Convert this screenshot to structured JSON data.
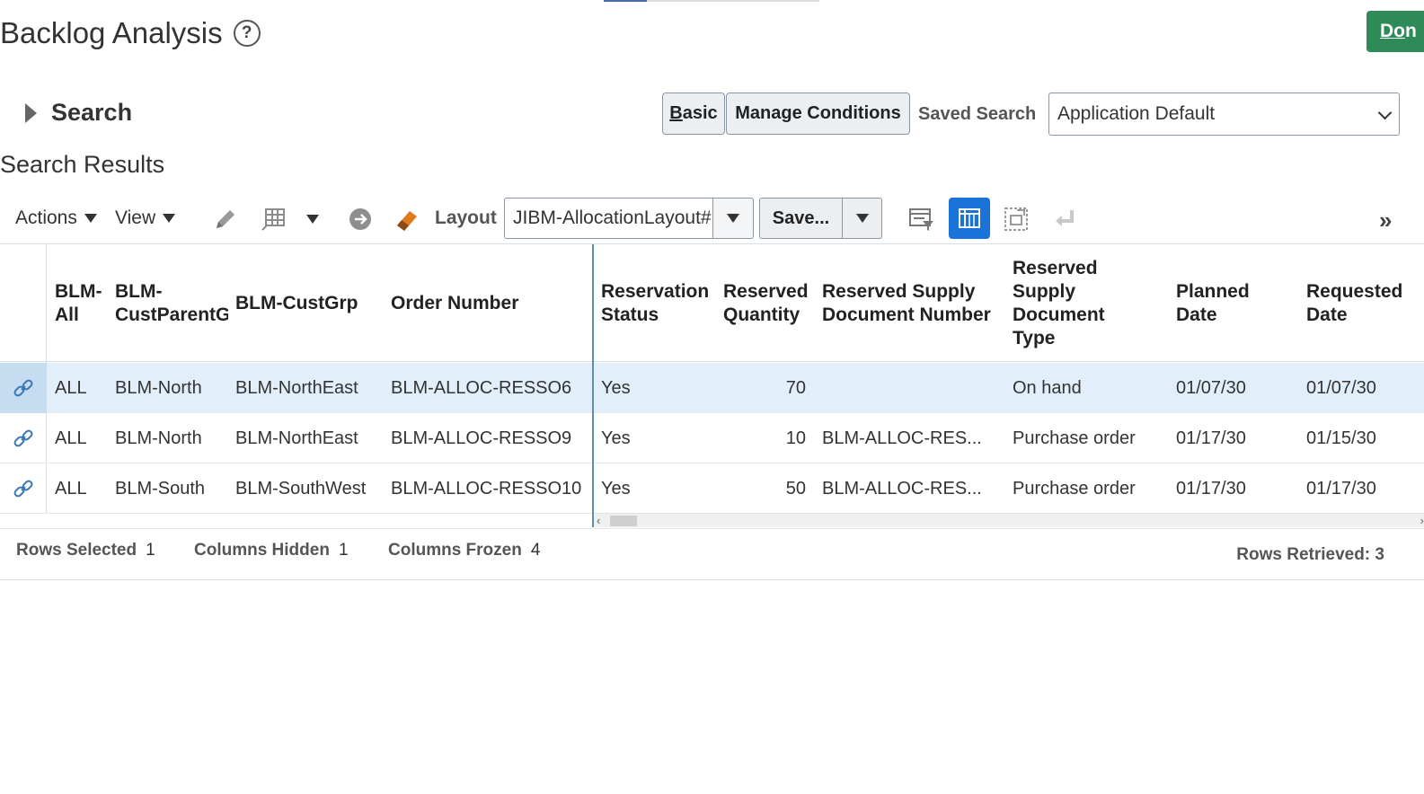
{
  "page": {
    "title": "Backlog Analysis",
    "done_label": "Do",
    "done_accel": "n"
  },
  "search": {
    "label": "Search",
    "basic_label": "asic",
    "basic_accel": "B",
    "manage_conditions_label": "Manage Conditions",
    "saved_search_label": "Saved Search",
    "saved_search_value": "Application Default"
  },
  "results": {
    "title": "Search Results",
    "toolbar": {
      "actions_label": "Actions",
      "view_label": "View",
      "layout_label": "Layout",
      "layout_value": "JIBM-AllocationLayout#",
      "save_label": "Save..."
    },
    "columns": [
      "BLM-All",
      "BLM-CustParentG",
      "BLM-CustGrp",
      "Order Number",
      "Reservation Status",
      "Reserved Quantity",
      "Reserved Supply Document Number",
      "Reserved Supply Document Type",
      "Planned Date",
      "Requested Date"
    ],
    "rows": [
      {
        "selected": true,
        "cells": [
          "ALL",
          "BLM-North",
          "BLM-NorthEast",
          "BLM-ALLOC-RESSO6",
          "Yes",
          "70",
          "",
          "On hand",
          "01/07/30",
          "01/07/30"
        ]
      },
      {
        "selected": false,
        "cells": [
          "ALL",
          "BLM-North",
          "BLM-NorthEast",
          "BLM-ALLOC-RESSO9",
          "Yes",
          "10",
          "BLM-ALLOC-RES...",
          "Purchase order",
          "01/17/30",
          "01/15/30"
        ]
      },
      {
        "selected": false,
        "cells": [
          "ALL",
          "BLM-South",
          "BLM-SouthWest",
          "BLM-ALLOC-RESSO10",
          "Yes",
          "50",
          "BLM-ALLOC-RES...",
          "Purchase order",
          "01/17/30",
          "01/17/30"
        ]
      }
    ],
    "status": {
      "rows_selected_label": "Rows Selected",
      "rows_selected_value": "1",
      "columns_hidden_label": "Columns Hidden",
      "columns_hidden_value": "1",
      "columns_frozen_label": "Columns Frozen",
      "columns_frozen_value": "4",
      "rows_retrieved": "Rows Retrieved: 3"
    }
  },
  "colors": {
    "done_button": "#2e8b57",
    "selected_row": "#e2effa",
    "freeze_toggle": "#1a73d9"
  },
  "icons": [
    "help-icon",
    "edit-pencil-icon",
    "column-grid-icon",
    "go-arrow-icon",
    "clear-eraser-icon",
    "query-filter-icon",
    "freeze-columns-icon",
    "detach-icon",
    "wrap-icon",
    "overflow-chevrons-icon",
    "row-link-icon"
  ]
}
